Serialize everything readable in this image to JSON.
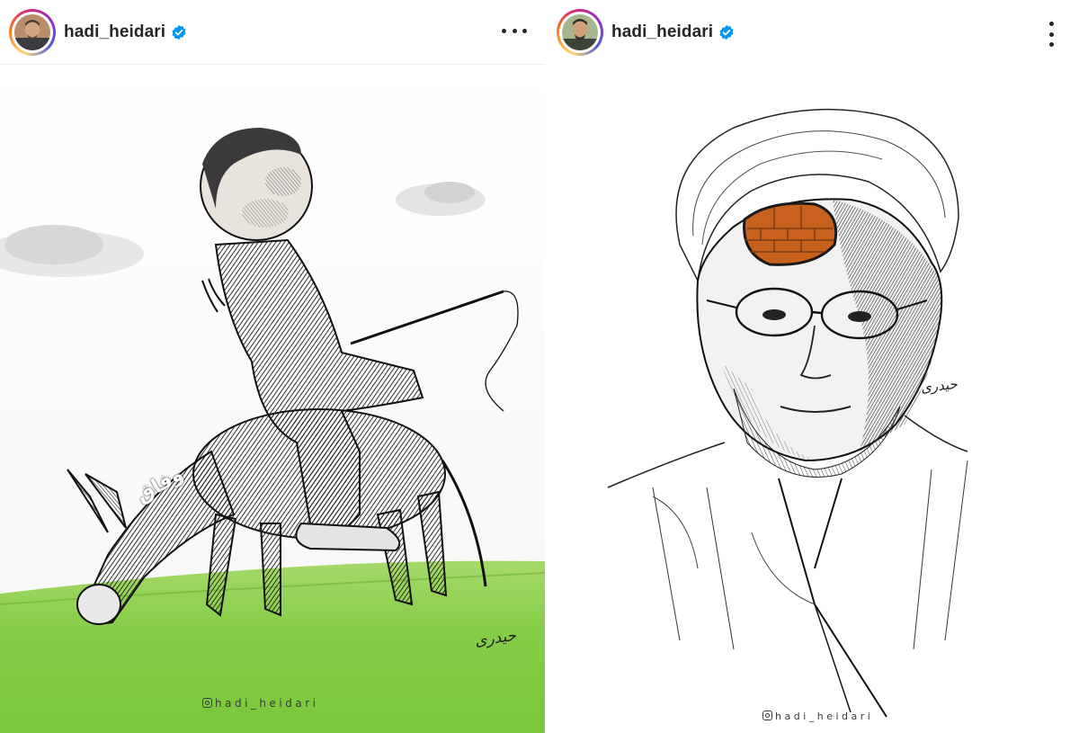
{
  "posts": [
    {
      "username": "hadi_heidari",
      "verified": true,
      "more_icon": "more-horizontal-icon",
      "artwork": {
        "caption_on_donkey": "وفاق",
        "watermark": "hadi_heidari",
        "signature": "حیدری"
      }
    },
    {
      "username": "hadi_heidari",
      "verified": true,
      "more_icon": "more-vertical-icon",
      "artwork": {
        "watermark": "hadi_heidari",
        "signature": "حیدری"
      }
    }
  ],
  "colors": {
    "verified_badge": "#0095f6",
    "username": "#262626",
    "grass_top": "#8fd04a",
    "grass_bottom": "#7cc63c",
    "brick": "#c8601e"
  }
}
